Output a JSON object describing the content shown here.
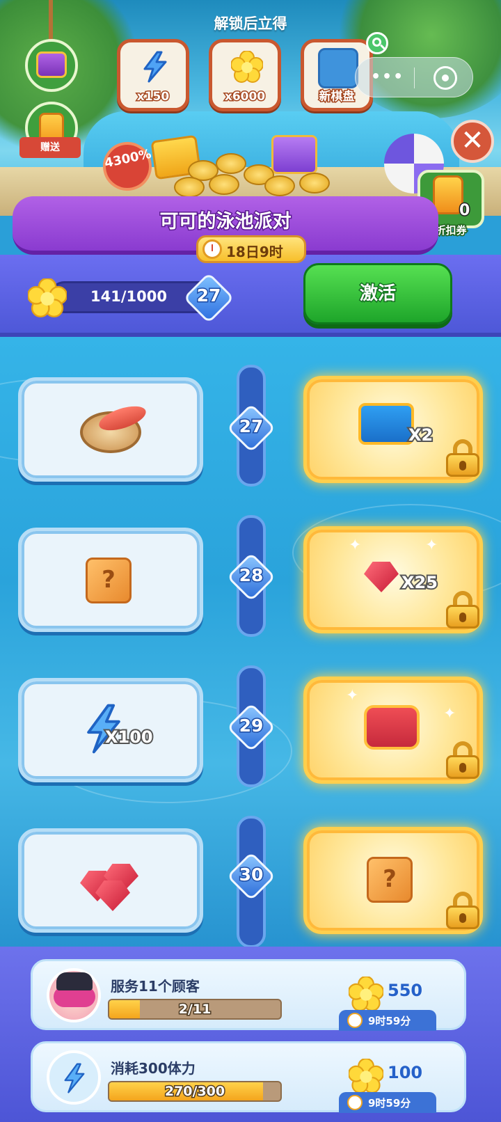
{
  "header": {
    "unlock_title": "解锁后立得",
    "rewards": [
      {
        "icon": "energy-bolt-icon",
        "label": "x150"
      },
      {
        "icon": "flower-coin-icon",
        "label": "x6000"
      },
      {
        "icon": "new-board-icon",
        "label": "新棋盘"
      }
    ],
    "percent_badge": "4300%",
    "gift_label": "赠送",
    "discount": {
      "count": "0",
      "label": "折扣券"
    }
  },
  "event": {
    "title": "可可的泳池派对",
    "timer": "18日9时",
    "progress_text": "141/1000",
    "progress_value": 141,
    "progress_max": 1000,
    "level": "27",
    "activate_label": "激活"
  },
  "levels": [
    {
      "level": "27",
      "free_item": "seafood-platter-icon",
      "paid_item": "blue-chest-icon",
      "paid_qty": "X2"
    },
    {
      "level": "28",
      "free_item": "mystery-box-icon",
      "paid_item": "ruby-gem-icon",
      "paid_qty": "X25"
    },
    {
      "level": "29",
      "free_item": "energy-bolt-icon",
      "free_qty": "X100",
      "paid_item": "red-chest-icon"
    },
    {
      "level": "30",
      "free_item": "ruby-gems-icon",
      "paid_item": "mystery-box-icon"
    }
  ],
  "tasks": [
    {
      "title": "服务11个顾客",
      "progress": "2/11",
      "progress_fraction": 0.18,
      "reward": "550",
      "timer": "9时59分",
      "icon": "customer-avatar-icon"
    },
    {
      "title": "消耗300体力",
      "progress": "270/300",
      "progress_fraction": 0.9,
      "reward": "100",
      "timer": "9时59分",
      "icon": "energy-bolt-icon"
    }
  ],
  "colors": {
    "accent_purple": "#8a3bd0",
    "activate_green": "#1ea52a",
    "pool_blue": "#2aa3db",
    "gold": "#ffcf4d"
  }
}
